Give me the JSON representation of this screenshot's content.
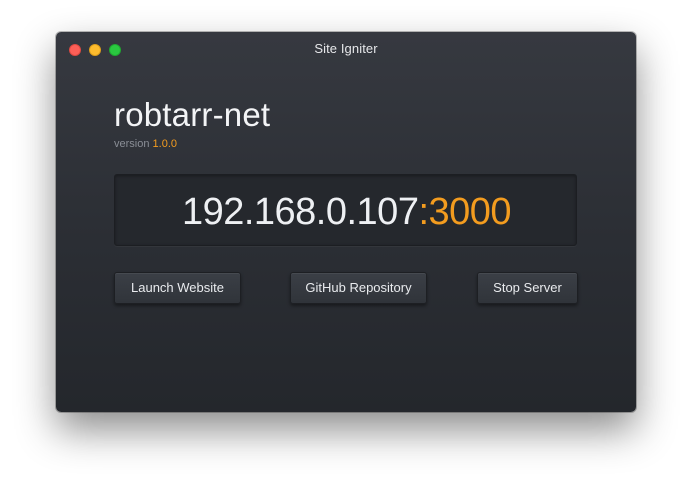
{
  "window": {
    "title": "Site Igniter"
  },
  "app": {
    "name": "robtarr-net",
    "version_label": "version",
    "version": "1.0.0"
  },
  "server": {
    "host": "192.168.0.107",
    "separator": ":",
    "port": "3000"
  },
  "buttons": {
    "launch": "Launch Website",
    "github": "GitHub Repository",
    "stop": "Stop Server"
  },
  "colors": {
    "accent": "#f39c1f",
    "window_bg": "#2b2e34",
    "close": "#fc5f57",
    "minimize": "#fdbc2e",
    "maximize": "#2ac840"
  }
}
